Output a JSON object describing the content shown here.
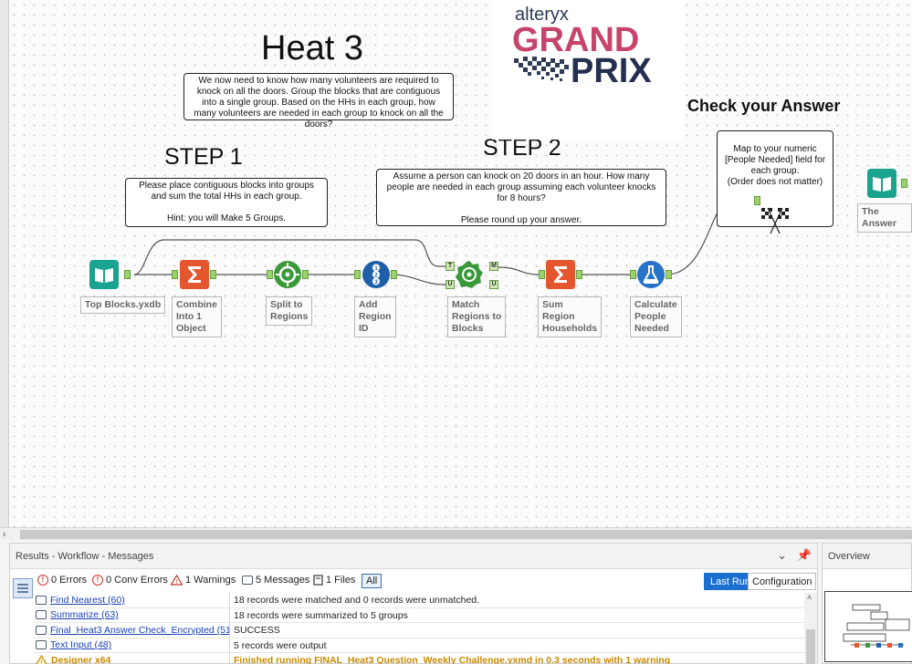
{
  "headings": {
    "heat": "Heat 3",
    "step1": "STEP 1",
    "step2": "STEP 2",
    "check": "Check your Answer"
  },
  "logo": {
    "brand": "alteryx",
    "line1": "GRAND",
    "line2": "PRIX"
  },
  "comments": {
    "intro": "We now need to know how many volunteers are required to knock on all the doors. Group the blocks that are contiguous into a single group. Based on the HHs in each group, how many volunteers are needed in each group to knock on all the doors?",
    "step1": "Please place contiguous blocks into groups and sum the total HHs in each group.\n\nHint: you will Make 5 Groups.",
    "step2": "Assume a person can knock on 20 doors in an hour. How many people are needed in each group assuming each volunteer knocks for 8 hours?\n\nPlease round up your answer.",
    "check": "Map to your numeric [People Needed] field for each group.\n(Order does not matter)"
  },
  "tools": {
    "input": "Top Blocks.yxdb",
    "combine": "Combine\nInto 1\nObject",
    "split": "Split to\nRegions",
    "region_id": "Add\nRegion\nID",
    "match": "Match\nRegions to\nBlocks",
    "sum": "Sum\nRegion\nHouseholds",
    "calc": "Calculate\nPeople\nNeeded",
    "answer": "The Answer"
  },
  "anchors": {
    "t": "T",
    "u": "U",
    "m": "M",
    "u2": "U"
  },
  "results": {
    "title": "Results - Workflow - Messages",
    "filters": {
      "errors": "0 Errors",
      "conv_errors": "0 Conv Errors",
      "warnings": "1 Warnings",
      "messages": "5 Messages",
      "files": "1 Files",
      "all": "All"
    },
    "last_run": "Last Run",
    "configuration": "Configuration",
    "rows": [
      {
        "tool": "Find Nearest (60)",
        "message": "18 records were matched and 0 records were unmatched."
      },
      {
        "tool": "Summarize (63)",
        "message": "18 records were summarized to 5 groups"
      },
      {
        "tool": "Final_Heat3 Answer Check_Encrypted (51)",
        "message": "SUCCESS"
      },
      {
        "tool": "Text Input (48)",
        "message": "5 records were output"
      },
      {
        "tool": "Designer x64",
        "message": "Finished running FINAL_Heat3 Question_Weekly Challenge.yxmd in 0.3 seconds with 1 warning"
      }
    ]
  },
  "overview": {
    "title": "Overview"
  },
  "colors": {
    "input_teal": "#1aa38f",
    "summarize_orange": "#e4572e",
    "spatial_green": "#3a9a3a",
    "recordid_blue": "#1f5fa8",
    "formula_blue": "#2673c8",
    "link_blue": "#1a3fb5",
    "warning_gold": "#c98a00"
  }
}
